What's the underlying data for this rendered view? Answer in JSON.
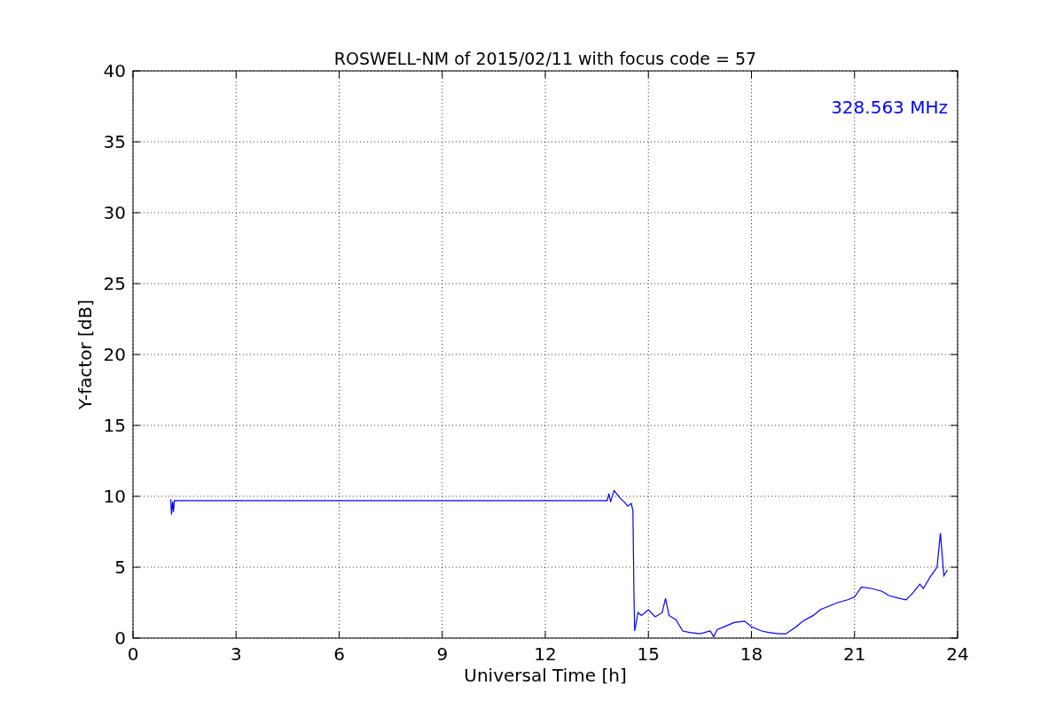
{
  "chart_data": {
    "type": "line",
    "title": "ROSWELL-NM of 2015/02/11 with focus code = 57",
    "xlabel": "Universal Time [h]",
    "ylabel": "Y-factor [dB]",
    "xlim": [
      0,
      24
    ],
    "ylim": [
      0,
      40
    ],
    "xticks": [
      0,
      3,
      6,
      9,
      12,
      15,
      18,
      21,
      24
    ],
    "yticks": [
      0,
      5,
      10,
      15,
      20,
      25,
      30,
      35,
      40
    ],
    "x": [
      1.1,
      1.12,
      1.15,
      1.18,
      1.2,
      13.8,
      13.85,
      13.9,
      14.0,
      14.1,
      14.2,
      14.3,
      14.4,
      14.5,
      14.55,
      14.58,
      14.6,
      14.7,
      14.8,
      15.0,
      15.2,
      15.4,
      15.5,
      15.6,
      15.8,
      16.0,
      16.2,
      16.5,
      16.8,
      16.9,
      17.0,
      17.3,
      17.5,
      17.8,
      18.0,
      18.3,
      18.5,
      18.8,
      19.0,
      19.3,
      19.5,
      19.8,
      20.0,
      20.3,
      20.5,
      20.8,
      21.0,
      21.2,
      21.5,
      21.8,
      22.0,
      22.3,
      22.5,
      22.7,
      22.9,
      23.0,
      23.2,
      23.4,
      23.5,
      23.6,
      23.7
    ],
    "grid": true,
    "series": [
      {
        "color": "#0000ff",
        "values": [
          9.8,
          8.7,
          9.6,
          8.9,
          9.7,
          9.7,
          10.2,
          9.6,
          10.4,
          10.1,
          9.8,
          9.6,
          9.3,
          9.5,
          9.0,
          3.0,
          0.5,
          1.8,
          1.6,
          2.0,
          1.5,
          1.8,
          2.8,
          1.6,
          1.3,
          0.5,
          0.4,
          0.3,
          0.5,
          0.1,
          0.6,
          0.9,
          1.1,
          1.2,
          0.8,
          0.5,
          0.4,
          0.3,
          0.3,
          0.8,
          1.2,
          1.6,
          2.0,
          2.3,
          2.5,
          2.7,
          2.9,
          3.6,
          3.5,
          3.3,
          3.0,
          2.8,
          2.7,
          3.2,
          3.8,
          3.5,
          4.3,
          5.0,
          7.4,
          4.4,
          4.8
        ]
      }
    ],
    "annotations": [
      {
        "text": "328.563 MHz"
      }
    ]
  }
}
